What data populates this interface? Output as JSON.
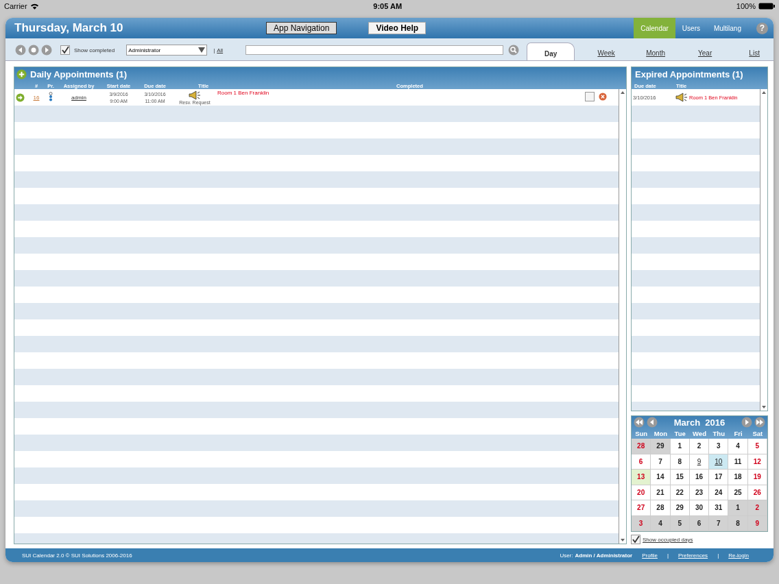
{
  "status_bar": {
    "carrier": "Carrier",
    "time": "9:05 AM",
    "battery": "100%"
  },
  "header": {
    "title": "Thursday, March 10",
    "buttons": [
      "App Navigation",
      "Video Help"
    ],
    "nav": [
      {
        "label": "Calendar",
        "selected": true
      },
      {
        "label": "Users",
        "selected": false
      },
      {
        "label": "Multilang",
        "selected": false
      }
    ],
    "help": "?"
  },
  "toolbar": {
    "show_completed": {
      "label": "Show completed",
      "checked": true
    },
    "user_select": "Administrator",
    "separator": "|",
    "all_link": "All"
  },
  "view_tabs": [
    {
      "label": "Day",
      "selected": true
    },
    {
      "label": "Week",
      "selected": false
    },
    {
      "label": "Month",
      "selected": false
    },
    {
      "label": "Year",
      "selected": false
    },
    {
      "label": "List",
      "selected": false
    }
  ],
  "daily": {
    "title": "Daily Appointments (1)",
    "columns": [
      "#",
      "Pr.",
      "Assigned by",
      "Start date",
      "Due date",
      "Title",
      "Completed"
    ],
    "rows": [
      {
        "number": "16",
        "assigned_by": "admin",
        "start_date": "3/9/2016",
        "start_time": "9:00 AM",
        "due_date": "3/10/2016",
        "due_time": "11:00 AM",
        "type": "Resv. Request",
        "title": "Room 1 Ben Franklin",
        "completed": false
      }
    ]
  },
  "expired": {
    "title": "Expired Appointments (1)",
    "columns": [
      "Due date",
      "Title"
    ],
    "rows": [
      {
        "due_date": "3/10/2016",
        "title": "Room 1 Ben Franklin"
      }
    ]
  },
  "mini_calendar": {
    "title": "March  2016",
    "weekdays": [
      "Sun",
      "Mon",
      "Tue",
      "Wed",
      "Thu",
      "Fri",
      "Sat"
    ],
    "days": [
      {
        "label": "28",
        "other_month": true,
        "weekend": true,
        "selected": false,
        "highlighted": false,
        "occupied": false
      },
      {
        "label": "29",
        "other_month": true,
        "weekend": false,
        "selected": false,
        "highlighted": false,
        "occupied": false
      },
      {
        "label": "1",
        "other_month": false,
        "weekend": false,
        "selected": false,
        "highlighted": false,
        "occupied": false
      },
      {
        "label": "2",
        "other_month": false,
        "weekend": false,
        "selected": false,
        "highlighted": false,
        "occupied": false
      },
      {
        "label": "3",
        "other_month": false,
        "weekend": false,
        "selected": false,
        "highlighted": false,
        "occupied": false
      },
      {
        "label": "4",
        "other_month": false,
        "weekend": false,
        "selected": false,
        "highlighted": false,
        "occupied": false
      },
      {
        "label": "5",
        "other_month": false,
        "weekend": true,
        "selected": false,
        "highlighted": false,
        "occupied": false
      },
      {
        "label": "6",
        "other_month": false,
        "weekend": true,
        "selected": false,
        "highlighted": false,
        "occupied": false
      },
      {
        "label": "7",
        "other_month": false,
        "weekend": false,
        "selected": false,
        "highlighted": false,
        "occupied": false
      },
      {
        "label": "8",
        "other_month": false,
        "weekend": false,
        "selected": false,
        "highlighted": false,
        "occupied": false
      },
      {
        "label": "9",
        "other_month": false,
        "weekend": false,
        "selected": false,
        "highlighted": false,
        "occupied": true
      },
      {
        "label": "10",
        "other_month": false,
        "weekend": false,
        "selected": true,
        "highlighted": false,
        "occupied": true
      },
      {
        "label": "11",
        "other_month": false,
        "weekend": false,
        "selected": false,
        "highlighted": false,
        "occupied": false
      },
      {
        "label": "12",
        "other_month": false,
        "weekend": true,
        "selected": false,
        "highlighted": false,
        "occupied": false
      },
      {
        "label": "13",
        "other_month": false,
        "weekend": true,
        "selected": false,
        "highlighted": true,
        "occupied": false
      },
      {
        "label": "14",
        "other_month": false,
        "weekend": false,
        "selected": false,
        "highlighted": false,
        "occupied": false
      },
      {
        "label": "15",
        "other_month": false,
        "weekend": false,
        "selected": false,
        "highlighted": false,
        "occupied": false
      },
      {
        "label": "16",
        "other_month": false,
        "weekend": false,
        "selected": false,
        "highlighted": false,
        "occupied": false
      },
      {
        "label": "17",
        "other_month": false,
        "weekend": false,
        "selected": false,
        "highlighted": false,
        "occupied": false
      },
      {
        "label": "18",
        "other_month": false,
        "weekend": false,
        "selected": false,
        "highlighted": false,
        "occupied": false
      },
      {
        "label": "19",
        "other_month": false,
        "weekend": true,
        "selected": false,
        "highlighted": false,
        "occupied": false
      },
      {
        "label": "20",
        "other_month": false,
        "weekend": true,
        "selected": false,
        "highlighted": false,
        "occupied": false
      },
      {
        "label": "21",
        "other_month": false,
        "weekend": false,
        "selected": false,
        "highlighted": false,
        "occupied": false
      },
      {
        "label": "22",
        "other_month": false,
        "weekend": false,
        "selected": false,
        "highlighted": false,
        "occupied": false
      },
      {
        "label": "23",
        "other_month": false,
        "weekend": false,
        "selected": false,
        "highlighted": false,
        "occupied": false
      },
      {
        "label": "24",
        "other_month": false,
        "weekend": false,
        "selected": false,
        "highlighted": false,
        "occupied": false
      },
      {
        "label": "25",
        "other_month": false,
        "weekend": false,
        "selected": false,
        "highlighted": false,
        "occupied": false
      },
      {
        "label": "26",
        "other_month": false,
        "weekend": true,
        "selected": false,
        "highlighted": false,
        "occupied": false
      },
      {
        "label": "27",
        "other_month": false,
        "weekend": true,
        "selected": false,
        "highlighted": false,
        "occupied": false
      },
      {
        "label": "28",
        "other_month": false,
        "weekend": false,
        "selected": false,
        "highlighted": false,
        "occupied": false
      },
      {
        "label": "29",
        "other_month": false,
        "weekend": false,
        "selected": false,
        "highlighted": false,
        "occupied": false
      },
      {
        "label": "30",
        "other_month": false,
        "weekend": false,
        "selected": false,
        "highlighted": false,
        "occupied": false
      },
      {
        "label": "31",
        "other_month": false,
        "weekend": false,
        "selected": false,
        "highlighted": false,
        "occupied": false
      },
      {
        "label": "1",
        "other_month": true,
        "weekend": false,
        "selected": false,
        "highlighted": false,
        "occupied": false
      },
      {
        "label": "2",
        "other_month": true,
        "weekend": true,
        "selected": false,
        "highlighted": false,
        "occupied": false
      },
      {
        "label": "3",
        "other_month": true,
        "weekend": true,
        "selected": false,
        "highlighted": false,
        "occupied": false
      },
      {
        "label": "4",
        "other_month": true,
        "weekend": false,
        "selected": false,
        "highlighted": false,
        "occupied": false
      },
      {
        "label": "5",
        "other_month": true,
        "weekend": false,
        "selected": false,
        "highlighted": false,
        "occupied": false
      },
      {
        "label": "6",
        "other_month": true,
        "weekend": false,
        "selected": false,
        "highlighted": false,
        "occupied": false
      },
      {
        "label": "7",
        "other_month": true,
        "weekend": false,
        "selected": false,
        "highlighted": false,
        "occupied": false
      },
      {
        "label": "8",
        "other_month": true,
        "weekend": false,
        "selected": false,
        "highlighted": false,
        "occupied": false
      },
      {
        "label": "9",
        "other_month": true,
        "weekend": true,
        "selected": false,
        "highlighted": false,
        "occupied": false
      }
    ]
  },
  "show_occupied": {
    "label": "Show occupied days",
    "checked": true
  },
  "footer": {
    "copyright": "SUI Calendar 2.0 © SUI Solutions 2006-2016",
    "user_label": "User:",
    "user": "Admin / Administrator",
    "separator": "|",
    "links": [
      "Profile",
      "Preferences",
      "Re-login"
    ]
  }
}
